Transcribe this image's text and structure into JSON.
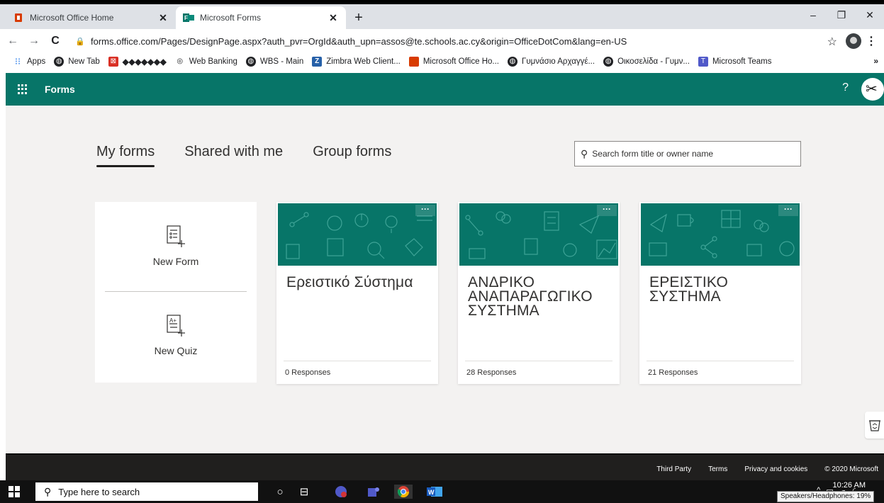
{
  "browser": {
    "tabs": [
      {
        "title": "Microsoft Office Home",
        "icon": "office-icon",
        "active": false
      },
      {
        "title": "Microsoft Forms",
        "icon": "forms-icon",
        "active": true
      }
    ],
    "url": "forms.office.com/Pages/DesignPage.aspx?auth_pvr=OrgId&auth_upn=assos@te.schools.ac.cy&origin=OfficeDotCom&lang=en-US",
    "bookmarks": [
      {
        "label": "Apps",
        "icon": "apps-grid-icon"
      },
      {
        "label": "New Tab",
        "icon": "globe-icon"
      },
      {
        "label": "◆◆◆◆◆◆◆",
        "icon": "page-icon"
      },
      {
        "label": "Web Banking",
        "icon": "bank-icon"
      },
      {
        "label": "WBS - Main",
        "icon": "globe-icon"
      },
      {
        "label": "Zimbra Web Client...",
        "icon": "zimbra-icon"
      },
      {
        "label": "Microsoft Office Ho...",
        "icon": "office-icon"
      },
      {
        "label": "Γυμνάσιο Αρχαγγέ...",
        "icon": "globe-icon"
      },
      {
        "label": "Οικοσελίδα - Γυμν...",
        "icon": "globe-icon"
      },
      {
        "label": "Microsoft Teams",
        "icon": "teams-icon"
      }
    ],
    "bookmarks_more": "»"
  },
  "header": {
    "app_name": "Forms",
    "help": "?",
    "brand_color": "#077568"
  },
  "main": {
    "tabs": [
      {
        "label": "My forms",
        "selected": true
      },
      {
        "label": "Shared with me",
        "selected": false
      },
      {
        "label": "Group forms",
        "selected": false
      }
    ],
    "search": {
      "placeholder": "Search form title or owner name"
    },
    "new_form_label": "New Form",
    "new_quiz_label": "New Quiz",
    "forms": [
      {
        "title": "Ερειστικό Σύστημα",
        "responses": "0 Responses"
      },
      {
        "title": "ΑΝΔΡΙΚΟ ΑΝΑΠΑΡΑΓΩΓΙΚΟ ΣΥΣΤΗΜΑ",
        "responses": "28 Responses"
      },
      {
        "title": "ΕΡΕΙΣΤΙΚΟ ΣΥΣΤΗΜΑ",
        "responses": "21 Responses"
      }
    ],
    "more_label": "···"
  },
  "footer": {
    "links": [
      "Third Party",
      "Terms",
      "Privacy and cookies",
      "© 2020 Microsoft"
    ]
  },
  "taskbar": {
    "search_placeholder": "Type here to search",
    "clock_time": "10:26 AM",
    "tooltip": "Speakers/Headphones: 19%"
  }
}
